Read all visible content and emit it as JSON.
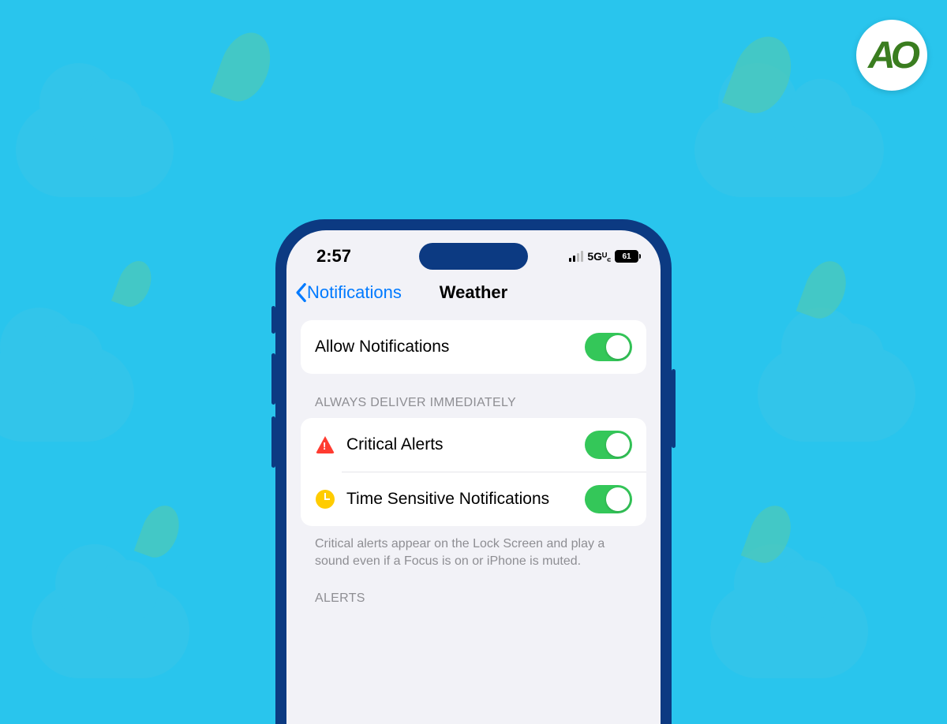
{
  "status": {
    "time": "2:57",
    "network": "5Gᵁ꜀",
    "battery": "61"
  },
  "nav": {
    "back_label": "Notifications",
    "title": "Weather"
  },
  "allow": {
    "label": "Allow Notifications"
  },
  "section1": {
    "header": "ALWAYS DELIVER IMMEDIATELY",
    "critical_label": "Critical Alerts",
    "time_sensitive_label": "Time Sensitive Notifications",
    "footer": "Critical alerts appear on the Lock Screen and play a sound even if a Focus is on or iPhone is muted."
  },
  "section2": {
    "header": "ALERTS"
  },
  "logo": {
    "text": "AO"
  }
}
